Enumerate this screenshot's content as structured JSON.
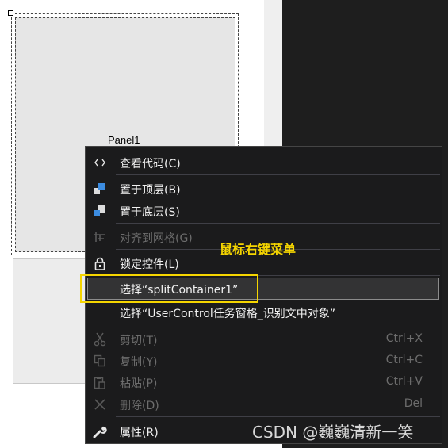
{
  "designer": {
    "panel1_label": "Panel1"
  },
  "context_menu": {
    "items": [
      {
        "label": "查看代码(C)",
        "icon": "code-icon",
        "enabled": true
      },
      {
        "label": "置于顶层(B)",
        "icon": "bring-to-front-icon",
        "enabled": true
      },
      {
        "label": "置于底层(S)",
        "icon": "send-to-back-icon",
        "enabled": true
      },
      {
        "label": "对齐到网格(G)",
        "icon": "align-to-grid-icon",
        "enabled": false
      },
      {
        "label": "锁定控件(L)",
        "icon": "lock-icon",
        "enabled": true
      },
      {
        "label": "选择“splitContainer1”",
        "icon": "",
        "enabled": true,
        "selected": true
      },
      {
        "label": "选择“UserControl任务窗格_识别文中对象”",
        "icon": "",
        "enabled": true
      },
      {
        "label": "剪切(T)",
        "shortcut": "Ctrl+X",
        "icon": "scissors-icon",
        "enabled": false
      },
      {
        "label": "复制(Y)",
        "shortcut": "Ctrl+C",
        "icon": "copy-icon",
        "enabled": false
      },
      {
        "label": "粘贴(P)",
        "shortcut": "Ctrl+V",
        "icon": "paste-icon",
        "enabled": false
      },
      {
        "label": "删除(D)",
        "shortcut": "Del",
        "icon": "delete-x-icon",
        "enabled": false
      },
      {
        "label": "属性(R)",
        "icon": "wrench-icon",
        "enabled": true
      }
    ]
  },
  "annotation": "鼠标右键菜单",
  "watermark": "CSDN @巍巍清新一笑",
  "colors": {
    "menu_bg": "#1b1b1c",
    "menu_text": "#f1f1f1",
    "disabled_text": "#6d6d6d",
    "highlight": "#f5d500",
    "icon_blue": "#3c8ce0"
  }
}
